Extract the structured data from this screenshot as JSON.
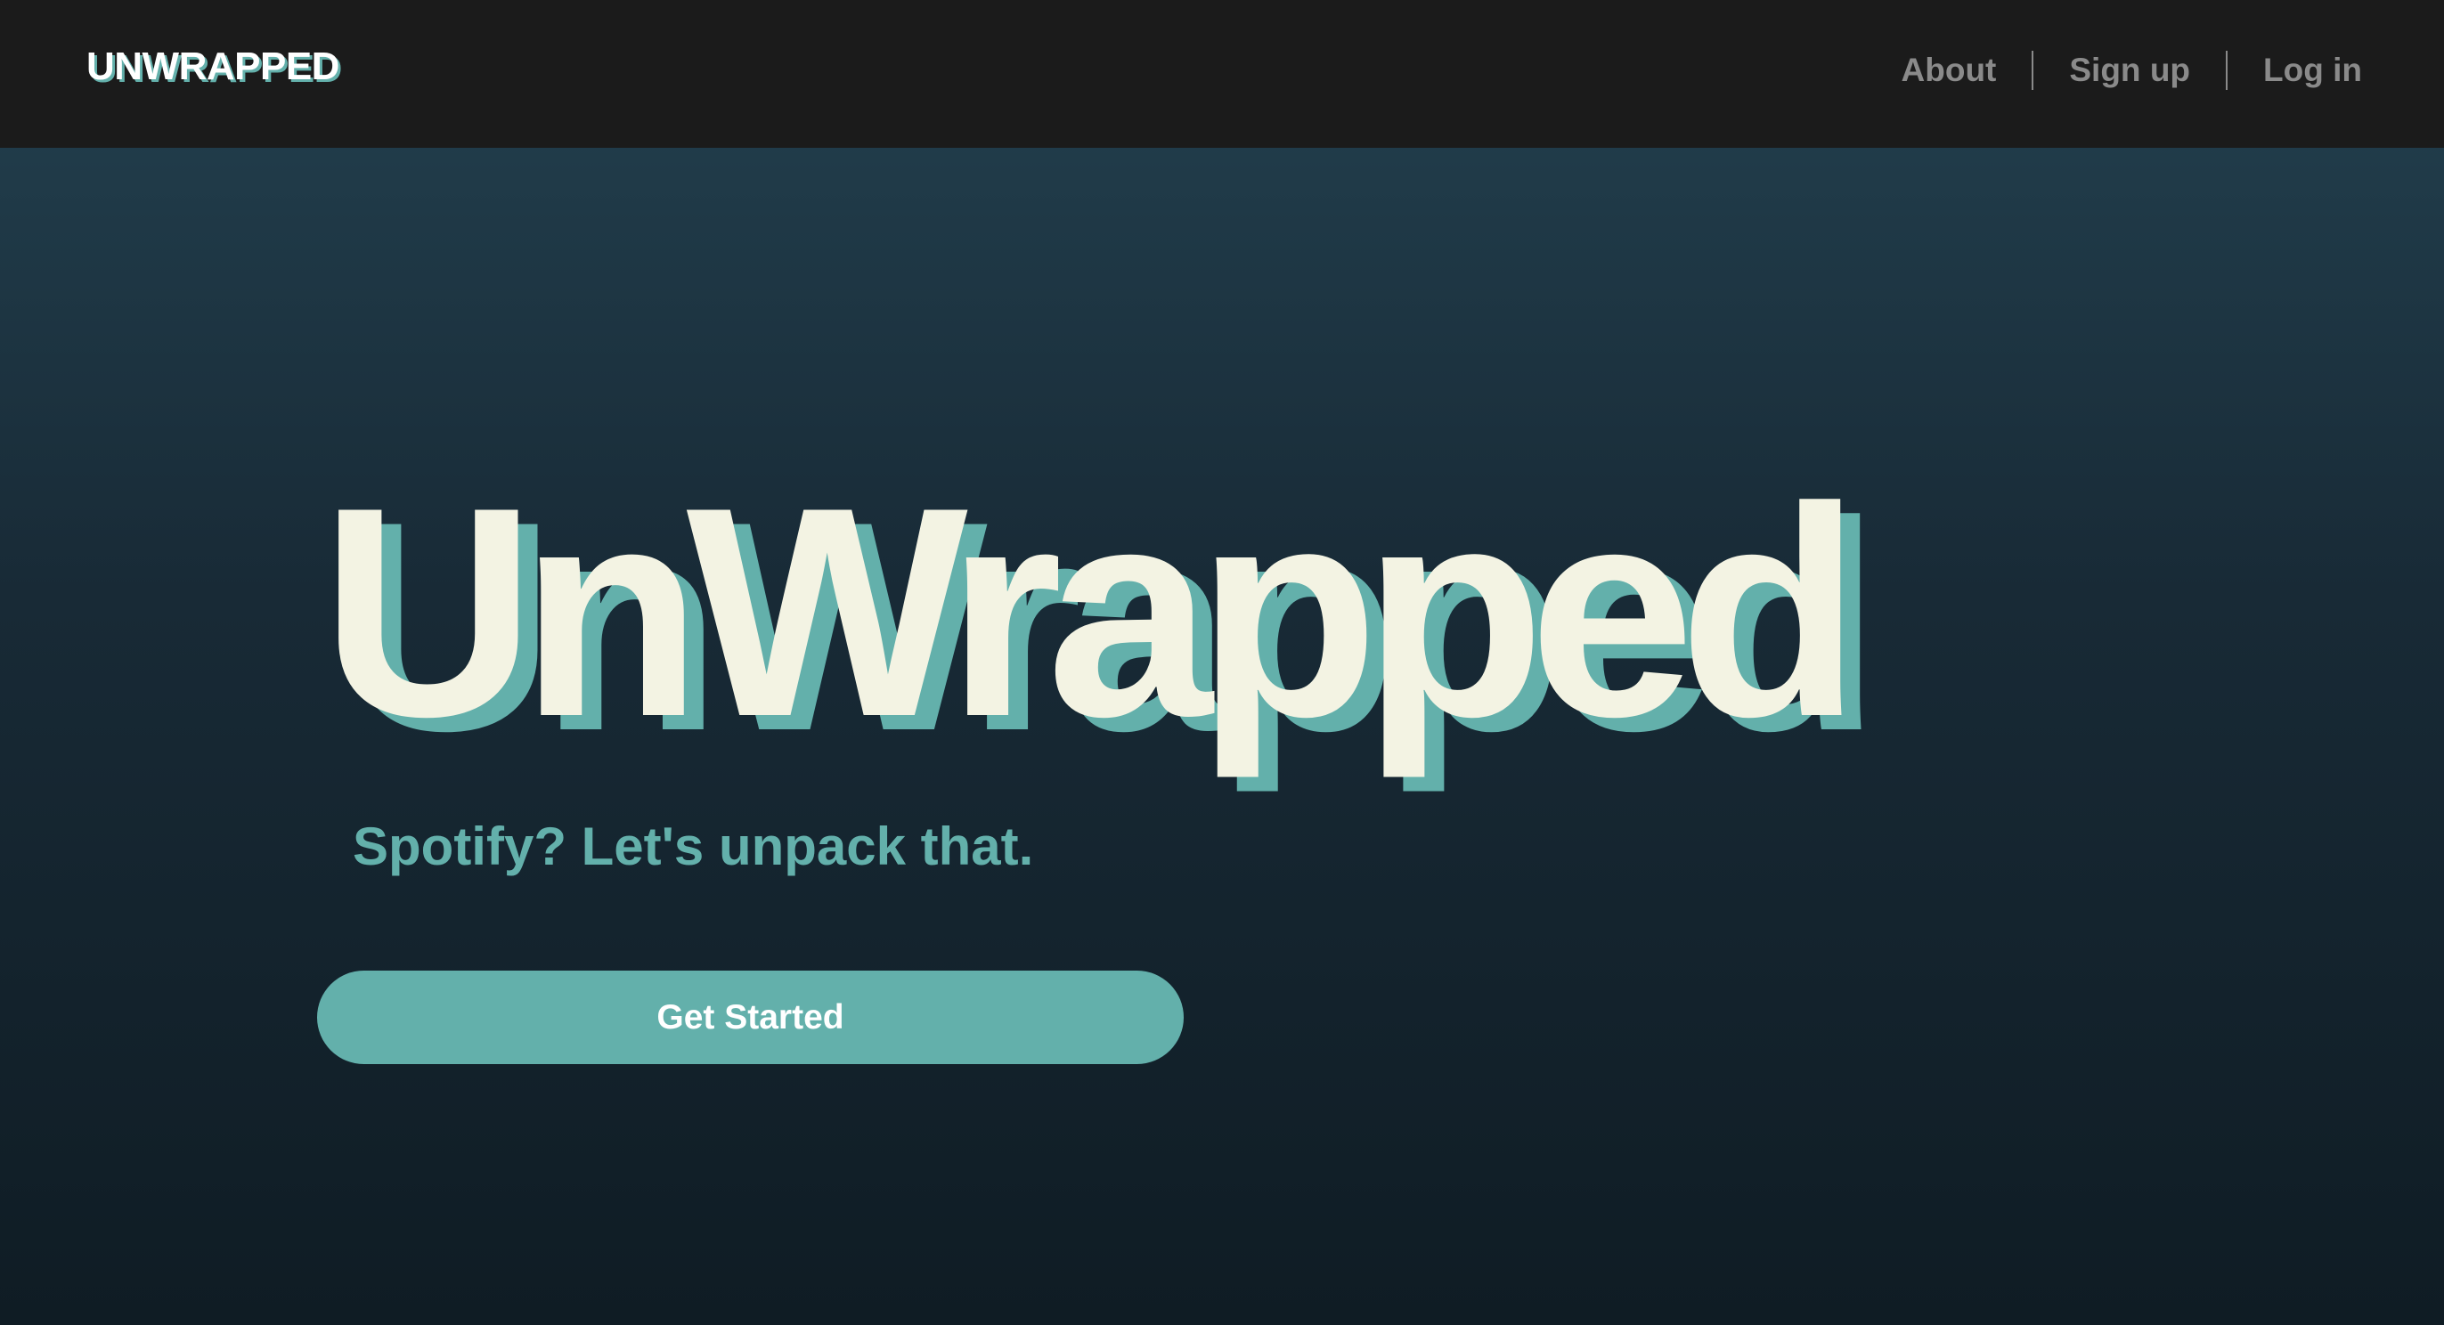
{
  "navbar": {
    "brand": "UNWRAPPED",
    "links": [
      {
        "label": "About"
      },
      {
        "label": "Sign up"
      },
      {
        "label": "Log in"
      }
    ]
  },
  "hero": {
    "title": "UnWrapped",
    "tagline": "Spotify? Let's unpack that.",
    "cta_label": "Get Started"
  },
  "colors": {
    "navbar_bg": "#1b1b1b",
    "accent": "#63b0ab",
    "title_text": "#f3f3e3",
    "nav_text": "#8a8a8a",
    "bg_top": "#234150",
    "bg_bottom": "#0f1c24"
  }
}
